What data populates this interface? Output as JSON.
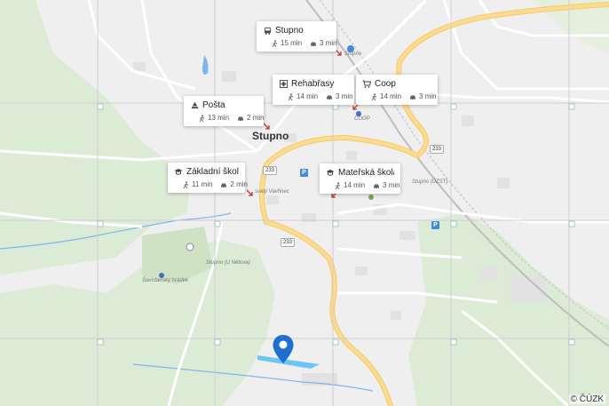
{
  "map": {
    "town_label": "Stupno",
    "copyright": "© ČÚZK",
    "small_labels": {
      "stupno_bus": "Stupno",
      "coop_small": "COOP",
      "stupno_station": "Stupno (ÚZST)",
      "vavrinec": "svatý Vavřinec",
      "unemocne": "Stupno (U Nětova)",
      "hrad": "Šternberský hrádek"
    },
    "road_numbers": [
      "233",
      "233",
      "233"
    ],
    "parking_label": "P"
  },
  "pois": [
    {
      "name": "Stupno",
      "icon": "bus-icon",
      "walk": "15 min",
      "drive": "3 min"
    },
    {
      "name": "Rehabřasy",
      "icon": "hospital-icon",
      "walk": "14 min",
      "drive": "3 min"
    },
    {
      "name": "Coop",
      "icon": "cart-icon",
      "walk": "14 min",
      "drive": "3 min"
    },
    {
      "name": "Pošta",
      "icon": "post-icon",
      "walk": "13 min",
      "drive": "2 min"
    },
    {
      "name": "Základní škola St…",
      "icon": "school-icon",
      "walk": "11 min",
      "drive": "2 min"
    },
    {
      "name": "Mateřská škola",
      "icon": "school-icon",
      "walk": "14 min",
      "drive": "3 min"
    }
  ],
  "colors": {
    "background": "#efefef",
    "forest": "#dcebd5",
    "water": "#7fb6f0",
    "road_major": "#fbdb8e",
    "road_minor": "#ffffff",
    "grid": "#cfcfcf",
    "marker": "#1f6fd1",
    "arrow": "#c0392b"
  }
}
